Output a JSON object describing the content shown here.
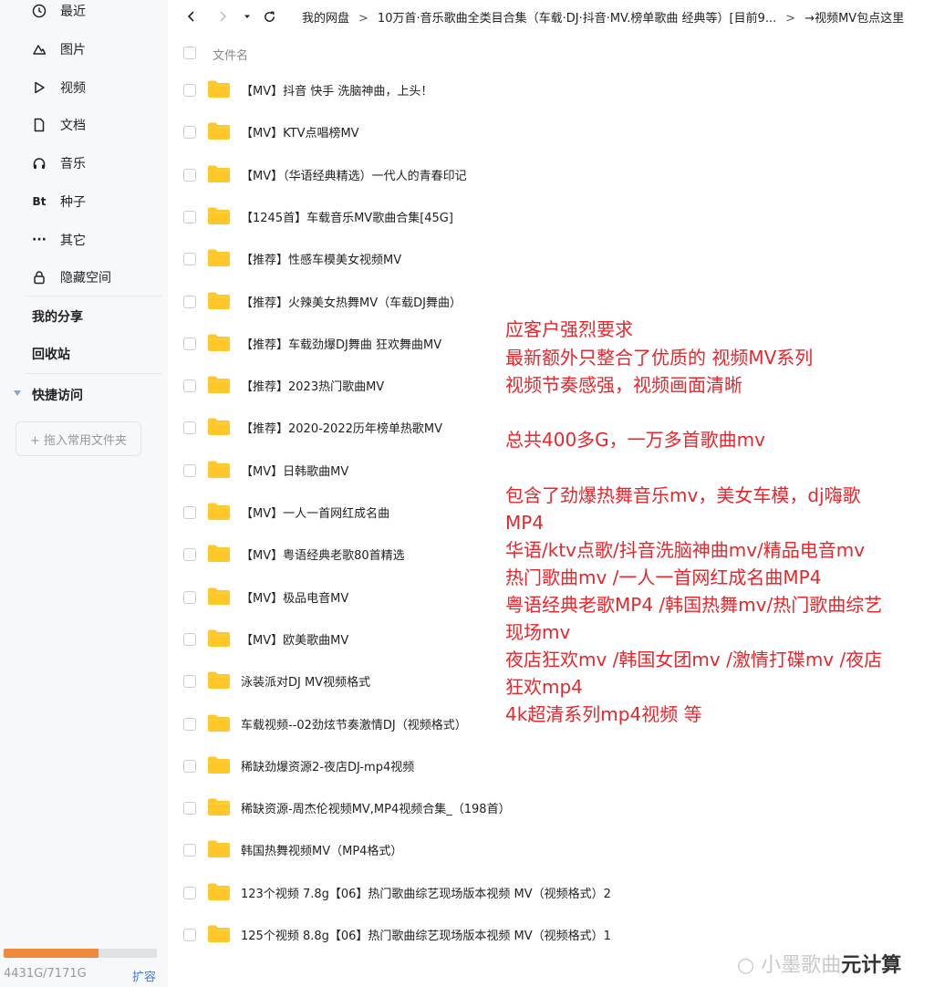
{
  "sidebar": {
    "items": [
      {
        "label": "最近",
        "icon": "clock-icon"
      },
      {
        "label": "图片",
        "icon": "image-icon"
      },
      {
        "label": "视频",
        "icon": "play-icon"
      },
      {
        "label": "文档",
        "icon": "document-icon"
      },
      {
        "label": "音乐",
        "icon": "headphones-icon"
      },
      {
        "label": "种子",
        "icon": "bt-icon",
        "glyph": "Bt"
      },
      {
        "label": "其它",
        "icon": "more-icon",
        "glyph": "···"
      },
      {
        "label": "隐藏空间",
        "icon": "lock-icon"
      }
    ],
    "my_share": "我的分享",
    "recycle": "回收站",
    "quick_access": "快捷访问",
    "add_folder": "+ 拖入常用文件夹",
    "storage": {
      "text": "4431G/7171G",
      "used_fraction": 0.618,
      "expand": "扩容"
    }
  },
  "toolbar": {
    "breadcrumb": [
      "我的网盘",
      "10万首·音乐歌曲全类目合集（车载·DJ·抖音·MV.榜单歌曲 经典等）[目前9...",
      "→视频MV包点这里"
    ]
  },
  "list": {
    "header": "文件名",
    "folders": [
      "【MV】抖音 快手 洗脑神曲，上头！",
      "【MV】KTV点唱榜MV",
      "【MV】（华语经典精选）一代人的青春印记",
      "【1245首】车载音乐MV歌曲合集[45G]",
      "【推荐】性感车模美女视频MV",
      "【推荐】火辣美女热舞MV（车载DJ舞曲）",
      "【推荐】车载劲爆DJ舞曲 狂欢舞曲MV",
      "【推荐】2023热门歌曲MV",
      "【推荐】2020-2022历年榜单热歌MV",
      "【MV】日韩歌曲MV",
      "【MV】一人一首网红成名曲",
      "【MV】粤语经典老歌80首精选",
      "【MV】极品电音MV",
      "【MV】欧美歌曲MV",
      "泳装派对DJ MV视频格式",
      "车载视频--02劲炫节奏激情DJ（视频格式）",
      "稀缺劲爆资源2-夜店DJ-mp4视频",
      "稀缺资源-周杰伦视频MV,MP4视频合集_（198首）",
      "韩国热舞视频MV（MP4格式）",
      "123个视频 7.8g【06】热门歌曲综艺现场版本视频 MV（视频格式）2",
      "125个视频 8.8g【06】热门歌曲综艺现场版本视频 MV（视频格式）1"
    ]
  },
  "annotation": {
    "lines": [
      "应客户强烈要求",
      "最新额外只整合了优质的 视频MV系列",
      "视频节奏感强，视频画面清晰",
      "总共400多G，一万多首歌曲mv",
      "包含了劲爆热舞音乐mv，美女车模，dj嗨歌",
      "MP4",
      "华语/ktv点歌/抖音洗脑神曲mv/精品电音mv",
      "热门歌曲mv /一人一首网红成名曲MP4",
      "粤语经典老歌MP4 /韩国热舞mv/热门歌曲综艺",
      "现场mv",
      "夜店狂欢mv /韩国女团mv /激情打碟mv /夜店",
      "狂欢mp4",
      "4k超清系列mp4视频 等"
    ]
  },
  "watermark": {
    "text": "小墨歌曲",
    "tail": "元计算"
  },
  "colors": {
    "folder": "#ffc727",
    "annotation": "#e8262b",
    "storage": "#f0883e",
    "link": "#3b7be8"
  }
}
